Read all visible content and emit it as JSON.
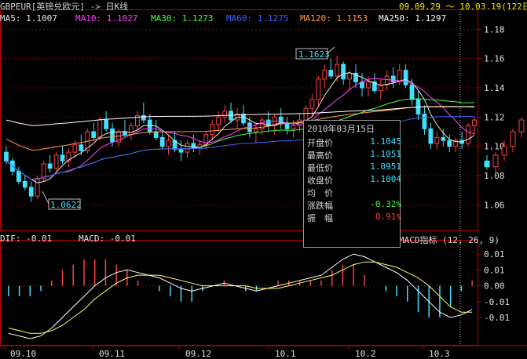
{
  "header": {
    "symbol_title": "GBPEUR[英镑兑欧元] -> 日K线",
    "date_range": "09.09.29 ～ 10.03.19(122日)"
  },
  "ma_legend": [
    {
      "label": "MA5: 1.1007",
      "color": "#e6e6e6"
    },
    {
      "label": "MA10: 1.1027",
      "color": "#ff40ff"
    },
    {
      "label": "MA30: 1.1273",
      "color": "#40ff40"
    },
    {
      "label": "MA60: 1.1275",
      "color": "#4060ff"
    },
    {
      "label": "MA120: 1.1153",
      "color": "#ffa040"
    },
    {
      "label": "MA250: 1.1297",
      "color": "#ffffff"
    }
  ],
  "price_axis": {
    "ticks": [
      "1.18",
      "1.16",
      "1.14",
      "1.12",
      "1.10",
      "1.08",
      "1.06"
    ]
  },
  "high_marker": "1.1623",
  "low_marker": "1.0622",
  "info_box": {
    "date": "2010年03月15日",
    "rows": [
      {
        "label": "开盘价",
        "value": "1.1045",
        "color": "#40e0ff"
      },
      {
        "label": "最高价",
        "value": "1.1051",
        "color": "#40e0ff"
      },
      {
        "label": "最低价",
        "value": "1.0951",
        "color": "#40e0ff"
      },
      {
        "label": "收盘价",
        "value": "1.1004",
        "color": "#40e0ff"
      },
      {
        "label": "均　价",
        "value": "",
        "color": "#40e0ff"
      },
      {
        "label": "涨跌幅",
        "value": "-0.32%",
        "color": "#40ff40"
      },
      {
        "label": "振　幅",
        "value": "0.91%",
        "color": "#ff4040"
      }
    ]
  },
  "macd": {
    "dif_label": "DIF: -0.01",
    "macd_label": "MACD: -0.01",
    "indicator_label": "MACD指标 (12, 26, 9)",
    "axis_ticks": [
      "0.01",
      "0.01",
      "0.00",
      "-0.01",
      "-0.01"
    ]
  },
  "x_axis": {
    "labels": [
      "09.10",
      "09.11",
      "09.12",
      "10.1",
      "10.2",
      "10.3"
    ]
  },
  "colors": {
    "up": "#ff4040",
    "down": "#40e0ff",
    "grid": "#8b0000",
    "axis": "#c00000"
  },
  "chart_data": {
    "type": "candlestick",
    "title": "GBPEUR[英镑兑欧元] 日K线",
    "y_range": [
      1.05,
      1.185
    ],
    "candles": [
      [
        1.096,
        1.1,
        1.088,
        1.09
      ],
      [
        1.09,
        1.092,
        1.08,
        1.083
      ],
      [
        1.083,
        1.086,
        1.074,
        1.076
      ],
      [
        1.076,
        1.08,
        1.07,
        1.072
      ],
      [
        1.072,
        1.076,
        1.062,
        1.066
      ],
      [
        1.066,
        1.08,
        1.064,
        1.078
      ],
      [
        1.078,
        1.09,
        1.076,
        1.088
      ],
      [
        1.088,
        1.094,
        1.082,
        1.085
      ],
      [
        1.085,
        1.096,
        1.083,
        1.094
      ],
      [
        1.094,
        1.1,
        1.088,
        1.09
      ],
      [
        1.09,
        1.098,
        1.086,
        1.096
      ],
      [
        1.096,
        1.104,
        1.092,
        1.101
      ],
      [
        1.101,
        1.108,
        1.094,
        1.097
      ],
      [
        1.097,
        1.112,
        1.095,
        1.11
      ],
      [
        1.11,
        1.116,
        1.104,
        1.106
      ],
      [
        1.106,
        1.12,
        1.104,
        1.118
      ],
      [
        1.118,
        1.124,
        1.11,
        1.112
      ],
      [
        1.112,
        1.116,
        1.1,
        1.103
      ],
      [
        1.103,
        1.112,
        1.1,
        1.11
      ],
      [
        1.11,
        1.118,
        1.106,
        1.108
      ],
      [
        1.108,
        1.116,
        1.104,
        1.114
      ],
      [
        1.114,
        1.124,
        1.11,
        1.121
      ],
      [
        1.121,
        1.13,
        1.116,
        1.118
      ],
      [
        1.118,
        1.122,
        1.108,
        1.11
      ],
      [
        1.11,
        1.118,
        1.104,
        1.106
      ],
      [
        1.106,
        1.11,
        1.098,
        1.1
      ],
      [
        1.1,
        1.108,
        1.094,
        1.104
      ],
      [
        1.104,
        1.11,
        1.096,
        1.098
      ],
      [
        1.098,
        1.104,
        1.09,
        1.096
      ],
      [
        1.096,
        1.104,
        1.092,
        1.102
      ],
      [
        1.102,
        1.108,
        1.096,
        1.099
      ],
      [
        1.099,
        1.104,
        1.094,
        1.101
      ],
      [
        1.101,
        1.11,
        1.098,
        1.108
      ],
      [
        1.108,
        1.118,
        1.104,
        1.115
      ],
      [
        1.115,
        1.124,
        1.11,
        1.12
      ],
      [
        1.12,
        1.128,
        1.116,
        1.124
      ],
      [
        1.124,
        1.13,
        1.116,
        1.118
      ],
      [
        1.118,
        1.126,
        1.112,
        1.122
      ],
      [
        1.122,
        1.128,
        1.114,
        1.116
      ],
      [
        1.116,
        1.12,
        1.106,
        1.11
      ],
      [
        1.11,
        1.116,
        1.102,
        1.112
      ],
      [
        1.112,
        1.12,
        1.108,
        1.118
      ],
      [
        1.118,
        1.124,
        1.11,
        1.114
      ],
      [
        1.114,
        1.122,
        1.108,
        1.12
      ],
      [
        1.12,
        1.126,
        1.112,
        1.116
      ],
      [
        1.116,
        1.12,
        1.108,
        1.112
      ],
      [
        1.112,
        1.118,
        1.106,
        1.114
      ],
      [
        1.114,
        1.122,
        1.11,
        1.118
      ],
      [
        1.118,
        1.128,
        1.116,
        1.126
      ],
      [
        1.126,
        1.136,
        1.12,
        1.132
      ],
      [
        1.132,
        1.148,
        1.128,
        1.146
      ],
      [
        1.146,
        1.156,
        1.14,
        1.152
      ],
      [
        1.152,
        1.16,
        1.146,
        1.148
      ],
      [
        1.148,
        1.162,
        1.144,
        1.156
      ],
      [
        1.156,
        1.158,
        1.142,
        1.146
      ],
      [
        1.146,
        1.152,
        1.138,
        1.15
      ],
      [
        1.15,
        1.156,
        1.14,
        1.144
      ],
      [
        1.144,
        1.15,
        1.134,
        1.14
      ],
      [
        1.14,
        1.148,
        1.134,
        1.144
      ],
      [
        1.144,
        1.15,
        1.136,
        1.138
      ],
      [
        1.138,
        1.146,
        1.132,
        1.142
      ],
      [
        1.142,
        1.152,
        1.138,
        1.148
      ],
      [
        1.148,
        1.154,
        1.14,
        1.144
      ],
      [
        1.144,
        1.156,
        1.142,
        1.152
      ],
      [
        1.152,
        1.156,
        1.14,
        1.142
      ],
      [
        1.142,
        1.146,
        1.128,
        1.132
      ],
      [
        1.132,
        1.138,
        1.118,
        1.122
      ],
      [
        1.122,
        1.128,
        1.108,
        1.112
      ],
      [
        1.112,
        1.116,
        1.098,
        1.102
      ],
      [
        1.102,
        1.11,
        1.098,
        1.106
      ],
      [
        1.106,
        1.112,
        1.1,
        1.104
      ],
      [
        1.104,
        1.108,
        1.096,
        1.1
      ],
      [
        1.1,
        1.106,
        1.096,
        1.104
      ],
      [
        1.104,
        1.11,
        1.098,
        1.102
      ],
      [
        1.102,
        1.116,
        1.1,
        1.114
      ],
      [
        1.114,
        1.12,
        1.108,
        1.118
      ]
    ],
    "macd_dif": [
      -0.018,
      -0.019,
      -0.02,
      -0.019,
      -0.016,
      -0.012,
      -0.008,
      -0.004,
      0.0,
      0.003,
      0.005,
      0.006,
      0.005,
      0.004,
      0.003,
      0.001,
      -0.001,
      -0.002,
      -0.001,
      0.0,
      0.001,
      0.0,
      -0.001,
      -0.002,
      -0.001,
      0.0,
      0.001,
      0.002,
      0.003,
      0.004,
      0.007,
      0.01,
      0.012,
      0.011,
      0.009,
      0.007,
      0.005,
      0.002,
      -0.002,
      -0.006,
      -0.01,
      -0.012,
      -0.011,
      -0.009
    ],
    "macd_dea": [
      -0.016,
      -0.017,
      -0.018,
      -0.018,
      -0.017,
      -0.015,
      -0.012,
      -0.009,
      -0.005,
      -0.002,
      0.001,
      0.003,
      0.004,
      0.004,
      0.004,
      0.003,
      0.002,
      0.001,
      0.0,
      0.0,
      0.0,
      0.0,
      0.0,
      -0.001,
      -0.001,
      -0.001,
      0.0,
      0.001,
      0.002,
      0.003,
      0.004,
      0.006,
      0.008,
      0.009,
      0.009,
      0.008,
      0.007,
      0.005,
      0.003,
      0.0,
      -0.004,
      -0.008,
      -0.01,
      -0.01
    ]
  }
}
